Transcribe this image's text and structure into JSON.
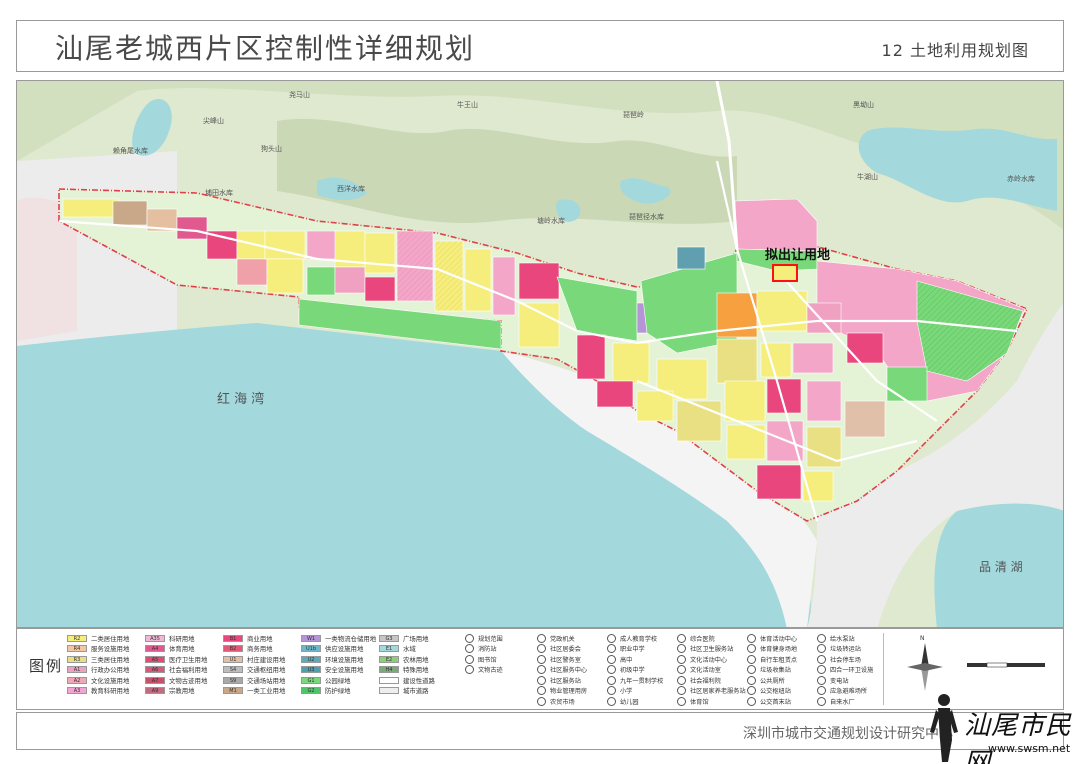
{
  "header": {
    "title": "汕尾老城西片区控制性详细规划",
    "sheet": "12 土地利用规划图"
  },
  "map": {
    "callout": "拟出让用地",
    "water_labels": {
      "bay": "红 海 湾",
      "lake": "品 清 湖"
    },
    "place_labels": [
      "尧马山",
      "牛王山",
      "琵琶岭",
      "黑坳山",
      "尖峰山",
      "狗头山",
      "赖角尾水库",
      "埔田水库",
      "西洋水库",
      "塘岭水库",
      "琵琶径水库",
      "牛湖山",
      "赤岭水库"
    ],
    "colors": {
      "residential_yellow": "#f6ee7c",
      "commercial_pink": "#f3a6c8",
      "commercial_magenta": "#e8467c",
      "green": "#79d97a",
      "water": "#a3d8dc",
      "hill": "#d9e6c9",
      "boundary_red": "#e0404a",
      "callout": "#ff1010"
    }
  },
  "legend": {
    "title": "图例",
    "land_use": [
      {
        "code": "R2",
        "label": "二类居住用地",
        "color": "#f6ee7c"
      },
      {
        "code": "R4",
        "label": "服务设施用地",
        "color": "#f3c6a4"
      },
      {
        "code": "R3",
        "label": "三类居住用地",
        "color": "#e8e083"
      },
      {
        "code": "A1",
        "label": "行政办公用地",
        "color": "#f0a0c0"
      },
      {
        "code": "A2",
        "label": "文化设施用地",
        "color": "#f0a8b8"
      },
      {
        "code": "A3",
        "label": "教育科研用地",
        "color": "#f4a4d0"
      },
      {
        "code": "A35",
        "label": "科研用地",
        "color": "#f0b8d6"
      },
      {
        "code": "A4",
        "label": "体育用地",
        "color": "#e05a90"
      },
      {
        "code": "A5",
        "label": "医疗卫生用地",
        "color": "#e64a70"
      },
      {
        "code": "A6",
        "label": "社会福利用地",
        "color": "#d85a7a"
      },
      {
        "code": "A7",
        "label": "文物古迹用地",
        "color": "#c8506a"
      },
      {
        "code": "A9",
        "label": "宗教用地",
        "color": "#c46a80"
      },
      {
        "code": "B1",
        "label": "商业用地",
        "color": "#e8467c"
      },
      {
        "code": "B2",
        "label": "商务用地",
        "color": "#e05a78"
      },
      {
        "code": "U1",
        "label": "村庄建设用地",
        "color": "#e0c0a8"
      },
      {
        "code": "S4",
        "label": "交通枢纽用地",
        "color": "#bdbdbd"
      },
      {
        "code": "S9",
        "label": "交通场站用地",
        "color": "#a9a9a9"
      },
      {
        "code": "M1",
        "label": "一类工业用地",
        "color": "#c8a888"
      },
      {
        "code": "W1",
        "label": "一类物流仓储用地",
        "color": "#b595d8"
      },
      {
        "code": "U1b",
        "label": "供应设施用地",
        "color": "#6fb7c7"
      },
      {
        "code": "U2",
        "label": "环境设施用地",
        "color": "#5faab8"
      },
      {
        "code": "U3",
        "label": "安全设施用地",
        "color": "#4f9fb0"
      },
      {
        "code": "G1",
        "label": "公园绿地",
        "color": "#79d97a"
      },
      {
        "code": "G2",
        "label": "防护绿地",
        "color": "#4fc56a"
      },
      {
        "code": "G3",
        "label": "广场用地",
        "color": "#c6c6c6"
      },
      {
        "code": "E1",
        "label": "水域",
        "color": "#a3d8dc"
      },
      {
        "code": "E2",
        "label": "农林用地",
        "color": "#8ccf7a"
      },
      {
        "code": "H4",
        "label": "特殊用地",
        "color": "#7aaa7a"
      },
      {
        "code": "",
        "label": "建设性道路",
        "color": "#ffffff"
      },
      {
        "code": "",
        "label": "城市道路",
        "color": "#eeeeee"
      }
    ],
    "symbols_col1": [
      "规划范围",
      "消防站",
      "图书馆",
      "文物古迹"
    ],
    "symbols": [
      "党政机关",
      "社区居委会",
      "社区警务室",
      "社区服务中心",
      "社区服务站",
      "物业管理用房",
      "农贸市场",
      "成人教育学校",
      "职业中学",
      "高中",
      "初级中学",
      "九年一贯制学校",
      "小学",
      "幼儿园",
      "综合医院",
      "社区卫生服务站",
      "文化活动中心",
      "文化活动室",
      "社会福利院",
      "社区居家养老服务站",
      "体育馆",
      "体育活动中心",
      "体育健身场地",
      "自行车租赁点",
      "垃圾收集站",
      "公共厕所",
      "公交枢纽站",
      "公交首末站",
      "给水泵站",
      "垃圾转运站",
      "社会停车场",
      "四合一环卫设施",
      "变电站",
      "应急避难场所",
      "自来水厂"
    ],
    "north": "N"
  },
  "footer": {
    "org": "深圳市城市交通规划设计研究中心"
  },
  "watermark": {
    "name": "汕尾市民网",
    "url": "www.swsm.net"
  }
}
